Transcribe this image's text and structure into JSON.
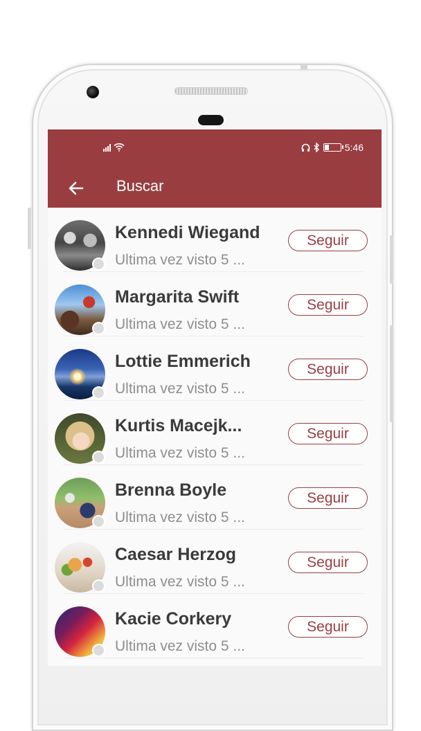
{
  "status_bar": {
    "time": "5:46"
  },
  "toolbar": {
    "title": "Buscar"
  },
  "users": [
    {
      "name": "Kennedi Wiegand",
      "last_seen": "Ultima vez visto 5 ...",
      "follow_label": "Seguir"
    },
    {
      "name": "Margarita Swift",
      "last_seen": "Ultima vez visto 5 ...",
      "follow_label": "Seguir"
    },
    {
      "name": "Lottie Emmerich",
      "last_seen": "Ultima vez visto 5 ...",
      "follow_label": "Seguir"
    },
    {
      "name": "Kurtis Macejk...",
      "last_seen": "Ultima vez visto 5 ...",
      "follow_label": "Seguir"
    },
    {
      "name": "Brenna Boyle",
      "last_seen": "Ultima vez visto 5 ...",
      "follow_label": "Seguir"
    },
    {
      "name": "Caesar Herzog",
      "last_seen": "Ultima vez visto 5 ...",
      "follow_label": "Seguir"
    },
    {
      "name": "Kacie Corkery",
      "last_seen": "Ultima vez visto 5 ...",
      "follow_label": "Seguir"
    }
  ],
  "colors": {
    "primary": "#993d41",
    "online_dot": "#dcdcdc"
  }
}
